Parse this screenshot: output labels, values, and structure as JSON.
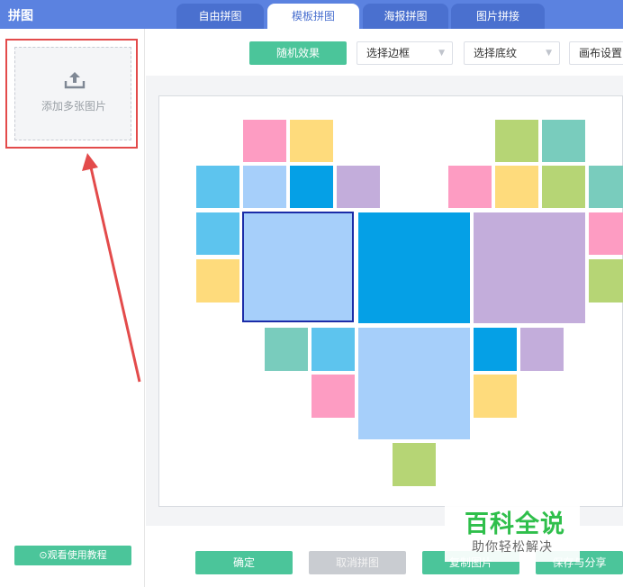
{
  "header": {
    "title": "拼图",
    "tabs": [
      {
        "label": "自由拼图",
        "active": false
      },
      {
        "label": "模板拼图",
        "active": true
      },
      {
        "label": "海报拼图",
        "active": false
      },
      {
        "label": "图片拼接",
        "active": false
      }
    ]
  },
  "left_panel": {
    "upload_label": "添加多张图片",
    "upload_icon": "upload-icon",
    "tutorial_button": "⊙观看使用教程"
  },
  "toolbar": {
    "random_button": "随机效果",
    "border_select": "选择边框",
    "texture_select": "选择底纹",
    "canvas_settings": "画布设置"
  },
  "bottom": {
    "confirm": "确定",
    "cancel": "取消拼图",
    "copy": "复制图片",
    "save_share": "保存与分享"
  },
  "watermark": {
    "brand": "百科全说",
    "slogan": "助你轻松解决"
  },
  "colors": {
    "header": "#5b82e0",
    "accent_green": "#4bc59a",
    "highlight_red": "#e34b4b",
    "pink": "#fd9cc2",
    "yellow": "#fedb7c",
    "blue_light": "#5dc4ee",
    "blue_pale": "#a6cffa",
    "blue_deep": "#05a0e6",
    "purple": "#c3addb",
    "green": "#b6d575",
    "teal": "#79ccbd",
    "selected_border": "#1b2ca8"
  }
}
